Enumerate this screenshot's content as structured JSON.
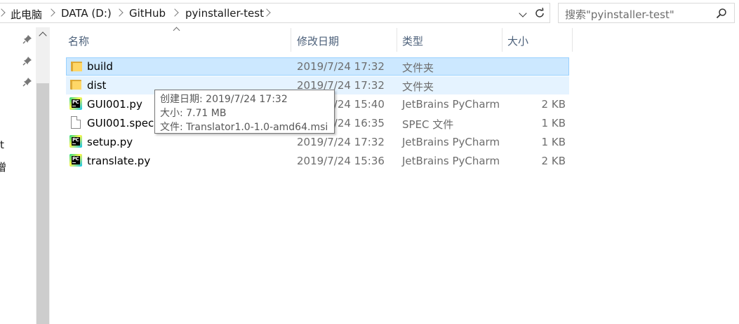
{
  "address_bar": {
    "crumbs": [
      "此电脑",
      "DATA (D:)",
      "GitHub",
      "pyinstaller-test"
    ]
  },
  "search": {
    "placeholder": "搜索\"pyinstaller-test\""
  },
  "nav_pane": {
    "fragments": [
      "t",
      "噌"
    ]
  },
  "columns": {
    "name": "名称",
    "date": "修改日期",
    "type": "类型",
    "size": "大小"
  },
  "files": [
    {
      "name": "build",
      "date": "2019/7/24 17:32",
      "type": "文件夹",
      "size": "",
      "icon": "folder-icon"
    },
    {
      "name": "dist",
      "date": "2019/7/24 17:32",
      "type": "文件夹",
      "size": "",
      "icon": "folder-icon"
    },
    {
      "name": "GUI001.py",
      "date": "2019/7/24 15:40",
      "type": "JetBrains PyCharm",
      "size": "2 KB",
      "icon": "pycharm-icon"
    },
    {
      "name": "GUI001.spec",
      "date": "2019/7/24 16:35",
      "type": "SPEC 文件",
      "size": "1 KB",
      "icon": "file-icon"
    },
    {
      "name": "setup.py",
      "date": "2019/7/24 17:32",
      "type": "JetBrains PyCharm",
      "size": "1 KB",
      "icon": "pycharm-icon"
    },
    {
      "name": "translate.py",
      "date": "2019/7/24 15:36",
      "type": "JetBrains PyCharm",
      "size": "2 KB",
      "icon": "pycharm-icon"
    }
  ],
  "tooltip": {
    "line1": "创建日期: 2019/7/24 17:32",
    "line2": "大小: 7.71 MB",
    "line3": "文件: Translator1.0-1.0-amd64.msi"
  },
  "colors": {
    "selected_row": "#cce8ff",
    "hover_row": "#e5f3ff",
    "header_text": "#4c607a"
  }
}
